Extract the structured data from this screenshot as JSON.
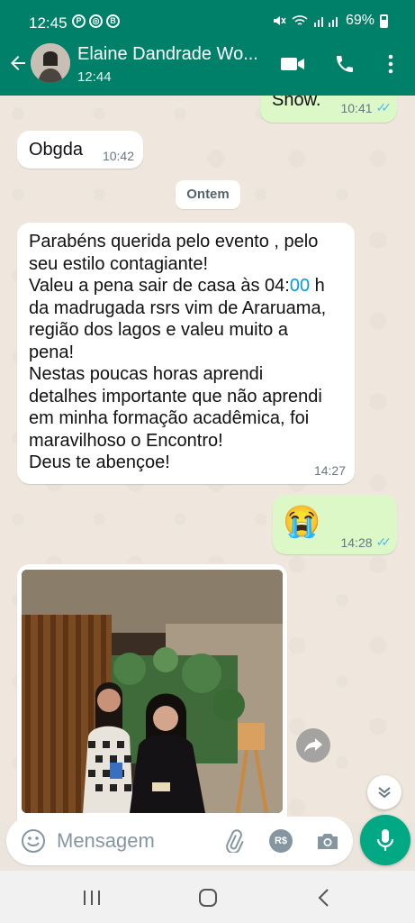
{
  "status_bar": {
    "time": "12:45",
    "icons": [
      "P",
      "◎",
      "B"
    ],
    "battery": "69%"
  },
  "header": {
    "contact_name": "Elaine Dandrade Wo...",
    "subtitle": "12:44"
  },
  "messages": [
    {
      "direction": "out",
      "text": "Show.",
      "time": "10:41",
      "ticks": "✓✓"
    },
    {
      "direction": "in",
      "text": "Obgda",
      "time": "10:42"
    },
    {
      "direction": "in",
      "lines": [
        "Parabéns querida pelo evento , pelo",
        "seu estilo contagiante!",
        "Valeu a pena sair de casa às 04:",
        "00",
        " h",
        "da madrugada rsrs vim de Araruama,",
        "região dos lagos e valeu muito a",
        "pena!",
        "Nestas poucas horas aprendi",
        "detalhes importante que não aprendi",
        "em minha formação acadêmica, foi",
        "maravilhoso o Encontro!",
        "Deus te abençoe!"
      ],
      "time": "14:27"
    },
    {
      "direction": "out",
      "text": "😭",
      "time": "14:28",
      "ticks": "✓✓"
    }
  ],
  "date_chip": "Ontem",
  "input": {
    "placeholder": "Mensagem",
    "rs_label": "R$"
  },
  "colors": {
    "header": "#008069",
    "outgoing": "#dcf8c6",
    "incoming": "#ffffff",
    "accent": "#00a884",
    "read_ticks": "#53bdeb"
  },
  "icons": [
    "back-arrow-icon",
    "video-call-icon",
    "phone-icon",
    "more-vert-icon",
    "forward-icon",
    "chevron-down-icon",
    "emoji-icon",
    "attach-icon",
    "camera-icon",
    "mic-icon",
    "recent-apps-icon",
    "home-icon",
    "back-nav-icon"
  ]
}
